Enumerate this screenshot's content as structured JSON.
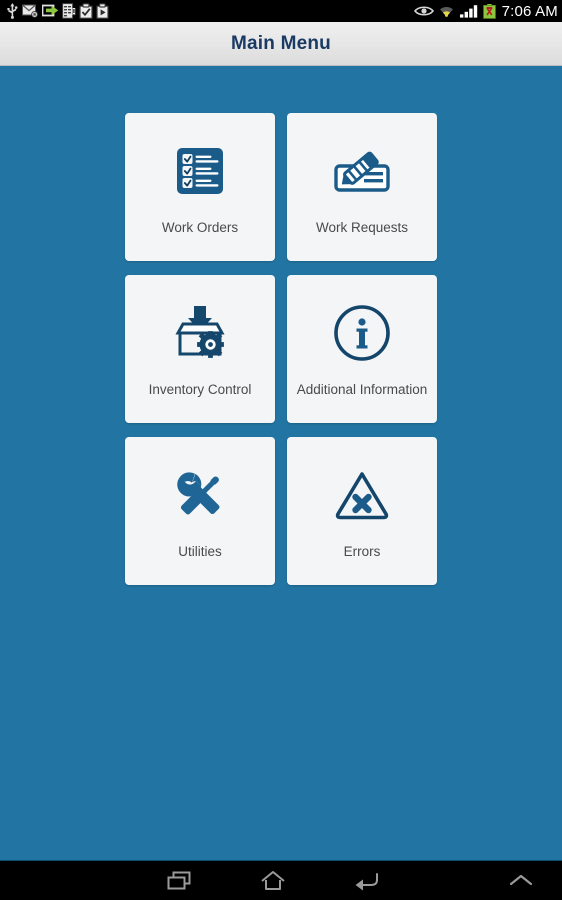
{
  "statusbar": {
    "left_icons": [
      {
        "name": "usb-icon",
        "label": "USB"
      },
      {
        "name": "email-icon",
        "label": "Email"
      },
      {
        "name": "export-arrow-icon",
        "label": "Data transfer"
      },
      {
        "name": "report-alert-icon",
        "label": "Report alert"
      },
      {
        "name": "checkbox-icon",
        "label": "Task complete"
      },
      {
        "name": "play-store-icon",
        "label": "Play Store"
      }
    ],
    "right_icons": [
      {
        "name": "eye-icon",
        "label": "Smart stay"
      },
      {
        "name": "wifi-icon",
        "label": "Wi-Fi"
      },
      {
        "name": "signal-bars-icon",
        "label": "Signal"
      },
      {
        "name": "battery-icon",
        "label": "Battery"
      }
    ],
    "clock": "7:06 AM"
  },
  "header": {
    "title": "Main Menu"
  },
  "menu": {
    "items": [
      {
        "label": "Work Orders",
        "icon": "checklist-icon"
      },
      {
        "label": "Work Requests",
        "icon": "pencil-form-icon"
      },
      {
        "label": "Inventory Control",
        "icon": "box-arrow-gear-icon"
      },
      {
        "label": "Additional Information",
        "icon": "info-circle-icon"
      },
      {
        "label": "Utilities",
        "icon": "wrench-screwdriver-icon"
      },
      {
        "label": "Errors",
        "icon": "warning-triangle-x-icon"
      }
    ]
  },
  "navbar": {
    "buttons": [
      {
        "name": "recents-button",
        "label": "Recents"
      },
      {
        "name": "home-button",
        "label": "Home"
      },
      {
        "name": "back-button",
        "label": "Back"
      },
      {
        "name": "expand-button",
        "label": "Expand"
      }
    ]
  },
  "colors": {
    "background_blue": "#2275a3",
    "icon_blue": "#1d5d8c",
    "icon_dark_blue": "#14456b",
    "tile_background": "#f4f5f6",
    "title_text": "#1b3a63",
    "label_text": "#4a4a4a"
  }
}
